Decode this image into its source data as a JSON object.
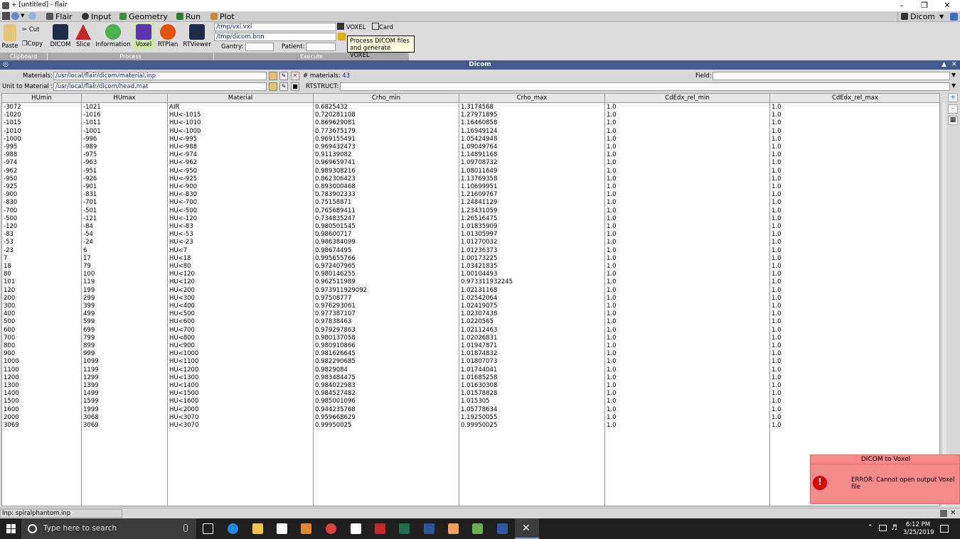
{
  "window": {
    "title": "+ [untitled] - flair"
  },
  "menubar": {
    "items": [
      "Flair",
      "Input",
      "Geometry",
      "Run",
      "Plot"
    ],
    "right_label": "Dicom"
  },
  "ribbon": {
    "clipboard": {
      "paste": "Paste",
      "cut": "Cut",
      "copy": "Copy",
      "group": "Clipboard"
    },
    "process": {
      "buttons": [
        "DICOM",
        "Slice",
        "Information",
        "Voxel",
        "RTPlan",
        "RTViewer"
      ],
      "group": "Process"
    },
    "execute": {
      "vxl_path": "/tmp/vxl.vxl",
      "bnn_path": "/tmp/dicom.bnn",
      "gantry_label": "Gantry:",
      "gantry_value": "",
      "patient_label": "Patient:",
      "patient_value": "",
      "voxel_button": "VOXEL",
      "card_button": "Card",
      "group": "Execute"
    },
    "tooltip": "Process DICOM files and generate VOXEL"
  },
  "panel": {
    "title": "Dicom",
    "materials_label": "Materials:",
    "materials_path": "/usr/local/flair/dicom/material.inp",
    "num_materials_label": "# materials:",
    "num_materials_value": "43",
    "field_label": "Field:",
    "field_value": "",
    "unit_label": "Unit to Material :",
    "unit_path": "/usr/local/flair/dicom/head.mat",
    "rtstruct_label": "RTSTRUCT:",
    "rtstruct_value": ""
  },
  "table": {
    "headers": [
      "HUmin",
      "HUmax",
      "Material",
      "Crho_min",
      "Crho_max",
      "CdEdx_rel_min",
      "CdEdx_rel_max"
    ],
    "rows": [
      [
        "-3072",
        "-1021",
        "AIR",
        "0.6825432",
        "1.3174568",
        "1.0",
        "1.0"
      ],
      [
        "-1020",
        "-1016",
        "HU<-1015",
        "0.720281108",
        "1.27971895",
        "1.0",
        "1.0"
      ],
      [
        "-1015",
        "-1011",
        "HU<-1010",
        "0.869629081",
        "1.16460858",
        "1.0",
        "1.0"
      ],
      [
        "-1010",
        "-1001",
        "HU<-1000",
        "0.773675179",
        "1.16949124",
        "1.0",
        "1.0"
      ],
      [
        "-1000",
        "-996",
        "HU<-995",
        "0.969155491",
        "1.05424948",
        "1.0",
        "1.0"
      ],
      [
        "-995",
        "-989",
        "HU<-988",
        "0.969432473",
        "1.09049764",
        "1.0",
        "1.0"
      ],
      [
        "-988",
        "-975",
        "HU<-974",
        "0.91139082",
        "1.14891168",
        "1.0",
        "1.0"
      ],
      [
        "-974",
        "-963",
        "HU<-962",
        "0.969659741",
        "1.09708732",
        "1.0",
        "1.0"
      ],
      [
        "-962",
        "-951",
        "HU<-950",
        "0.989308216",
        "1.08011649",
        "1.0",
        "1.0"
      ],
      [
        "-950",
        "-926",
        "HU<-925",
        "0.862306423",
        "1.13769358",
        "1.0",
        "1.0"
      ],
      [
        "-925",
        "-901",
        "HU<-900",
        "0.893000468",
        "1.10699951",
        "1.0",
        "1.0"
      ],
      [
        "-900",
        "-831",
        "HU<-830",
        "0.783902333",
        "1.21609767",
        "1.0",
        "1.0"
      ],
      [
        "-830",
        "-701",
        "HU<-700",
        "0.75158871",
        "1.24841129",
        "1.0",
        "1.0"
      ],
      [
        "-700",
        "-501",
        "HU<-500",
        "0.765689411",
        "1.23431059",
        "1.0",
        "1.0"
      ],
      [
        "-500",
        "-121",
        "HU<-120",
        "0.734835247",
        "1.26516475",
        "1.0",
        "1.0"
      ],
      [
        "-120",
        "-84",
        "HU<-83",
        "0.980501545",
        "1.01835909",
        "1.0",
        "1.0"
      ],
      [
        "-83",
        "-54",
        "HU<-53",
        "0.98600717",
        "1.01305997",
        "1.0",
        "1.0"
      ],
      [
        "-53",
        "-24",
        "HU<-23",
        "0.986384099",
        "1.01270032",
        "1.0",
        "1.0"
      ],
      [
        "-23",
        "6",
        "HU<7",
        "0.98674495",
        "1.01236373",
        "1.0",
        "1.0"
      ],
      [
        "7",
        "17",
        "HU<18",
        "0.995655766",
        "1.00173225",
        "1.0",
        "1.0"
      ],
      [
        "18",
        "79",
        "HU<80",
        "0.972407965",
        "1.03421835",
        "1.0",
        "1.0"
      ],
      [
        "80",
        "100",
        "HU<120",
        "0.980146255",
        "1.00104493",
        "1.0",
        "1.0"
      ],
      [
        "101",
        "119",
        "HU<120",
        "0.962511989",
        "0.973311932245",
        "1.0",
        "1.0"
      ],
      [
        "120",
        "199",
        "HU<200",
        "0.973911929092",
        "1.02131168",
        "1.0",
        "1.0"
      ],
      [
        "200",
        "299",
        "HU<300",
        "0.97508777",
        "1.02542064",
        "1.0",
        "1.0"
      ],
      [
        "300",
        "399",
        "HU<400",
        "0.976293061",
        "1.02419075",
        "1.0",
        "1.0"
      ],
      [
        "400",
        "499",
        "HU<500",
        "0.977387107",
        "1.02307438",
        "1.0",
        "1.0"
      ],
      [
        "500",
        "599",
        "HU<600",
        "0.97838463",
        "1.0220565",
        "1.0",
        "1.0"
      ],
      [
        "600",
        "699",
        "HU<700",
        "0.979297863",
        "1.02112463",
        "1.0",
        "1.0"
      ],
      [
        "700",
        "799",
        "HU<800",
        "0.980137058",
        "1.02026831",
        "1.0",
        "1.0"
      ],
      [
        "800",
        "899",
        "HU<900",
        "0.980910866",
        "1.01947871",
        "1.0",
        "1.0"
      ],
      [
        "900",
        "999",
        "HU<1000",
        "0.981626645",
        "1.01874832",
        "1.0",
        "1.0"
      ],
      [
        "1000",
        "1099",
        "HU<1100",
        "0.982290685",
        "1.01807073",
        "1.0",
        "1.0"
      ],
      [
        "1100",
        "1199",
        "HU<1200",
        "0.9829084",
        "1.01744041",
        "1.0",
        "1.0"
      ],
      [
        "1200",
        "1299",
        "HU<1300",
        "0.983484475",
        "1.01685258",
        "1.0",
        "1.0"
      ],
      [
        "1300",
        "1399",
        "HU<1400",
        "0.984022983",
        "1.01630308",
        "1.0",
        "1.0"
      ],
      [
        "1400",
        "1499",
        "HU<1500",
        "0.984527482",
        "1.01578828",
        "1.0",
        "1.0"
      ],
      [
        "1500",
        "1599",
        "HU<1600",
        "0.985001096",
        "1.015305",
        "1.0",
        "1.0"
      ],
      [
        "1600",
        "1999",
        "HU<2000",
        "0.944235768",
        "1.05778634",
        "1.0",
        "1.0"
      ],
      [
        "2000",
        "3068",
        "HU<3070",
        "0.959668629",
        "1.19250055",
        "1.0",
        "1.0"
      ],
      [
        "3069",
        "3069",
        "HU<3070",
        "0.99950025",
        "0.99950025",
        "1.0",
        "1.0"
      ]
    ]
  },
  "status": {
    "text": "Inp: spiralphantom.inp"
  },
  "error_popup": {
    "title": "DICOM to Voxel",
    "icon": "!",
    "message": "ERROR: Cannot open output Voxel file"
  },
  "taskbar": {
    "search_placeholder": "Type here to search",
    "time": "6:12 PM",
    "date": "3/25/2019"
  },
  "colors": {
    "panel_title_bg": "#445a8b",
    "error_bg": "#f48a8a",
    "taskbar_bg": "#1f1f1f"
  }
}
